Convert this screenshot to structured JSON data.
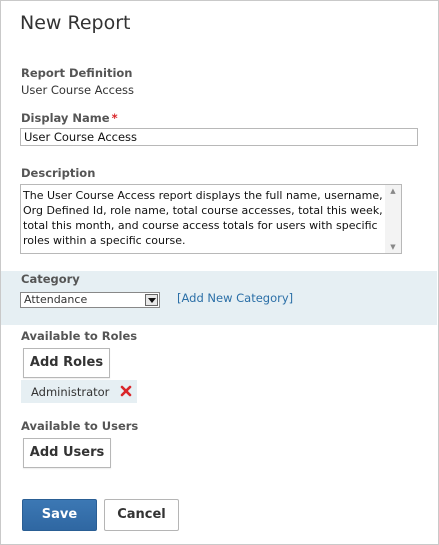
{
  "page": {
    "title": "New Report"
  },
  "report_definition": {
    "label": "Report Definition",
    "value": "User Course Access"
  },
  "display_name": {
    "label": "Display Name",
    "required_mark": "*",
    "value": "User Course Access"
  },
  "description": {
    "label": "Description",
    "value": "The User Course Access report displays the full name, username, Org Defined Id, role name, total course accesses, total this week, total this month, and course access totals for users with specific roles within a specific course."
  },
  "category": {
    "label": "Category",
    "selected": "Attendance",
    "add_link": "[Add New Category]"
  },
  "roles": {
    "label": "Available to Roles",
    "add_button": "Add Roles",
    "items": [
      {
        "name": "Administrator"
      }
    ]
  },
  "users": {
    "label": "Available to Users",
    "add_button": "Add Users"
  },
  "actions": {
    "save": "Save",
    "cancel": "Cancel"
  },
  "colors": {
    "accent": "#2f67a2",
    "band": "#e6eff3",
    "link": "#2b6fa7",
    "danger": "#d9262a"
  },
  "icons": {
    "remove": "close-icon",
    "select_arrow": "chevron-down-icon"
  }
}
